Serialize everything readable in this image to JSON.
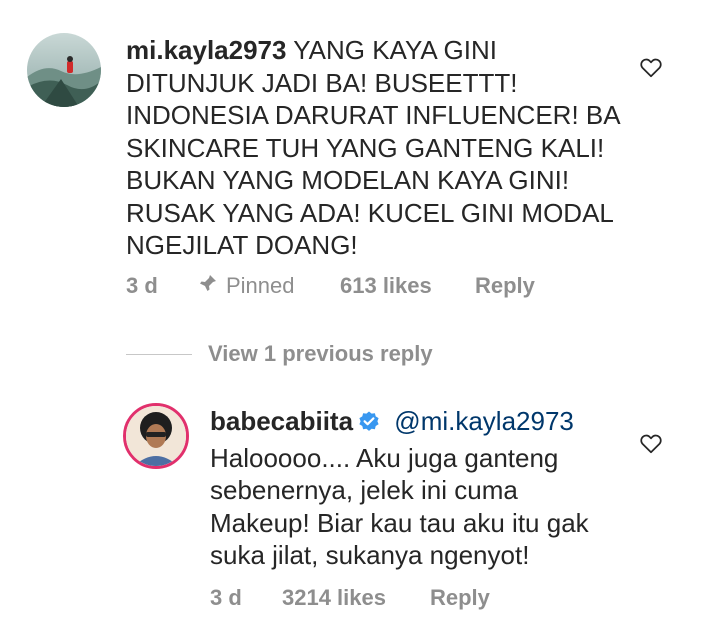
{
  "comment": {
    "username": "mi.kayla2973",
    "text_lines": [
      "YANG KAYA GINI",
      "DITUNJUK JADI BA! BUSEETTT!",
      "INDONESIA DARURAT INFLUENCER! BA",
      "SKINCARE TUH YANG GANTENG KALI!",
      "BUKAN YANG MODELAN KAYA GINI!",
      "RUSAK YANG ADA! KUCEL GINI MODAL",
      "NGEJILAT DOANG!"
    ],
    "time": "3 d",
    "pinned_label": "Pinned",
    "likes": "613 likes",
    "reply_label": "Reply",
    "icons": {
      "like": "heart-outline-icon",
      "pin": "pin-icon"
    }
  },
  "view_replies_label": "View 1 previous reply",
  "reply": {
    "username": "babecabiita",
    "mention": "@mi.kayla2973",
    "text_lines": [
      "Halooooo.... Aku juga ganteng",
      "sebenernya, jelek ini cuma",
      "Makeup! Biar kau tau aku itu gak",
      "suka jilat, sukanya ngenyot!"
    ],
    "time": "3 d",
    "likes": "3214 likes",
    "reply_label": "Reply",
    "icons": {
      "like": "heart-outline-icon",
      "verified": "verified-badge-icon"
    }
  },
  "colors": {
    "text": "#262626",
    "meta": "#8e8e8e",
    "mention": "#00376b",
    "verified": "#3897f0",
    "divider": "#c7c7c7"
  }
}
